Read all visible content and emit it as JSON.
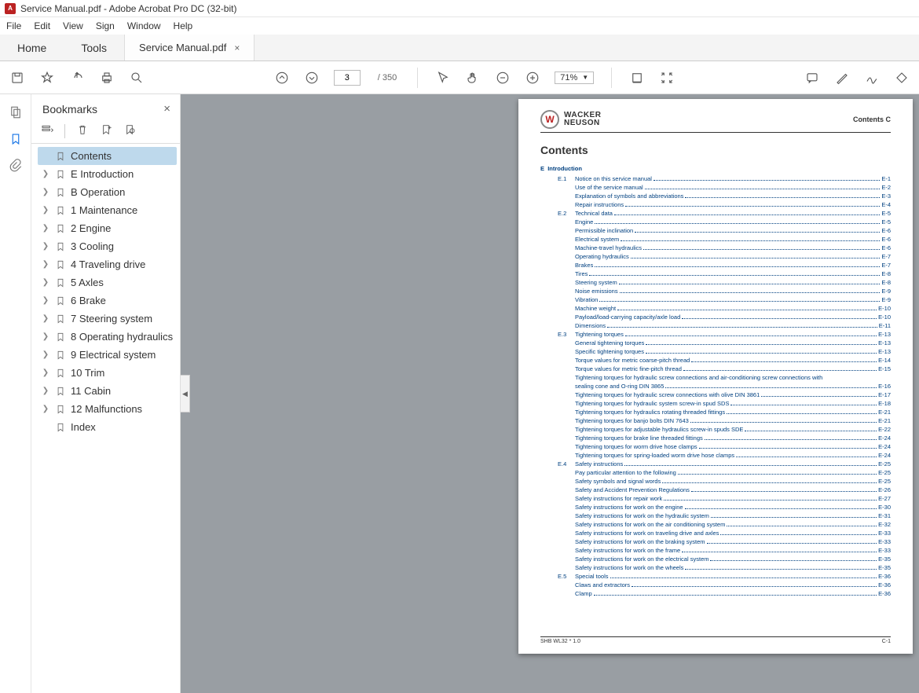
{
  "window_title": "Service Manual.pdf - Adobe Acrobat Pro DC (32-bit)",
  "menu": [
    "File",
    "Edit",
    "View",
    "Sign",
    "Window",
    "Help"
  ],
  "main_tabs": {
    "home": "Home",
    "tools": "Tools"
  },
  "doc_tab": "Service Manual.pdf",
  "page_current": "3",
  "page_total": "/ 350",
  "zoom": "71%",
  "sidebar_title": "Bookmarks",
  "bookmarks": [
    {
      "label": "Contents",
      "exp": false,
      "selected": true
    },
    {
      "label": "E Introduction",
      "exp": true
    },
    {
      "label": "B Operation",
      "exp": true
    },
    {
      "label": "1 Maintenance",
      "exp": true
    },
    {
      "label": "2 Engine",
      "exp": true
    },
    {
      "label": "3 Cooling",
      "exp": true
    },
    {
      "label": "4 Traveling drive",
      "exp": true
    },
    {
      "label": "5 Axles",
      "exp": true
    },
    {
      "label": "6 Brake",
      "exp": true
    },
    {
      "label": "7 Steering system",
      "exp": true
    },
    {
      "label": "8 Operating hydraulics",
      "exp": true
    },
    {
      "label": "9 Electrical system",
      "exp": true
    },
    {
      "label": "10 Trim",
      "exp": true
    },
    {
      "label": "11 Cabin",
      "exp": true
    },
    {
      "label": "12 Malfunctions",
      "exp": true
    },
    {
      "label": "Index",
      "exp": false
    }
  ],
  "page_header_right": "Contents  C",
  "brand_top": "WACKER",
  "brand_bottom": "NEUSON",
  "page_title": "Contents",
  "section_letter": "E",
  "section_title": "Introduction",
  "toc": [
    {
      "lvl": 1,
      "num": "E.1",
      "txt": "Notice on this service manual",
      "pg": "E-1"
    },
    {
      "lvl": 2,
      "txt": "Use of the service manual",
      "pg": "E-2"
    },
    {
      "lvl": 2,
      "txt": "Explanation of symbols and abbreviations",
      "pg": "E-3"
    },
    {
      "lvl": 2,
      "txt": "Repair instructions",
      "pg": "E-4"
    },
    {
      "lvl": 1,
      "num": "E.2",
      "txt": "Technical data",
      "pg": "E-5"
    },
    {
      "lvl": 2,
      "txt": "Engine",
      "pg": "E-5"
    },
    {
      "lvl": 2,
      "txt": "Permissible inclination",
      "pg": "E-6"
    },
    {
      "lvl": 2,
      "txt": "Electrical system",
      "pg": "E-6"
    },
    {
      "lvl": 2,
      "txt": "Machine-travel hydraulics",
      "pg": "E-6"
    },
    {
      "lvl": 2,
      "txt": "Operating hydraulics",
      "pg": "E-7"
    },
    {
      "lvl": 2,
      "txt": "Brakes",
      "pg": "E-7"
    },
    {
      "lvl": 2,
      "txt": "Tires",
      "pg": "E-8"
    },
    {
      "lvl": 2,
      "txt": "Steering system",
      "pg": "E-8"
    },
    {
      "lvl": 2,
      "txt": "Noise emissions",
      "pg": "E-9"
    },
    {
      "lvl": 2,
      "txt": "Vibration",
      "pg": "E-9"
    },
    {
      "lvl": 2,
      "txt": "Machine weight",
      "pg": "E-10"
    },
    {
      "lvl": 2,
      "txt": "Payload/load-carrying capacity/axle load",
      "pg": "E-10"
    },
    {
      "lvl": 2,
      "txt": "Dimensions",
      "pg": "E-11"
    },
    {
      "lvl": 1,
      "num": "E.3",
      "txt": "Tightening torques",
      "pg": "E-13"
    },
    {
      "lvl": 2,
      "txt": "General tightening torques",
      "pg": "E-13"
    },
    {
      "lvl": 2,
      "txt": "Specific tightening torques",
      "pg": "E-13"
    },
    {
      "lvl": 2,
      "txt": "Torque values for metric coarse-pitch thread",
      "pg": "E-14"
    },
    {
      "lvl": 2,
      "txt": "Torque values for metric fine-pitch thread",
      "pg": "E-15"
    },
    {
      "lvl": 2,
      "txt": "Tightening torques for hydraulic screw connections and air-conditioning screw connections with sealing cone and O-ring DIN 3865",
      "pg": "E-16",
      "wrap": true
    },
    {
      "lvl": 2,
      "txt": "Tightening torques for hydraulic screw connections with olive DIN 3861",
      "pg": "E-17"
    },
    {
      "lvl": 2,
      "txt": "Tightening torques for hydraulic system screw-in spud SDS",
      "pg": "E-18"
    },
    {
      "lvl": 2,
      "txt": "Tightening torques for hydraulics rotating threaded fittings",
      "pg": "E-21"
    },
    {
      "lvl": 2,
      "txt": "Tightening torques for banjo bolts DIN 7643",
      "pg": "E-21"
    },
    {
      "lvl": 2,
      "txt": "Tightening torques for adjustable hydraulics screw-in spuds SDE",
      "pg": "E-22"
    },
    {
      "lvl": 2,
      "txt": "Tightening torques for brake line threaded fittings",
      "pg": "E-24"
    },
    {
      "lvl": 2,
      "txt": "Tightening torques for worm drive hose clamps",
      "pg": "E-24"
    },
    {
      "lvl": 2,
      "txt": "Tightening torques for spring-loaded worm drive hose clamps",
      "pg": "E-24"
    },
    {
      "lvl": 1,
      "num": "E.4",
      "txt": "Safety instructions",
      "pg": "E-25"
    },
    {
      "lvl": 2,
      "txt": "Pay particular attention to the following",
      "pg": "E-25"
    },
    {
      "lvl": 2,
      "txt": "Safety symbols and signal words",
      "pg": "E-25"
    },
    {
      "lvl": 2,
      "txt": "Safety and Accident Prevention Regulations",
      "pg": "E-26"
    },
    {
      "lvl": 2,
      "txt": "Safety instructions for repair work",
      "pg": "E-27"
    },
    {
      "lvl": 2,
      "txt": "Safety instructions for work on the engine",
      "pg": "E-30"
    },
    {
      "lvl": 2,
      "txt": "Safety instructions for work on the hydraulic system",
      "pg": "E-31"
    },
    {
      "lvl": 2,
      "txt": "Safety instructions for work on the air conditioning system",
      "pg": "E-32"
    },
    {
      "lvl": 2,
      "txt": "Safety instructions for work on traveling drive and axles",
      "pg": "E-33"
    },
    {
      "lvl": 2,
      "txt": "Safety instructions for work on the braking system",
      "pg": "E-33"
    },
    {
      "lvl": 2,
      "txt": "Safety instructions for work on the frame",
      "pg": "E-33"
    },
    {
      "lvl": 2,
      "txt": "Safety instructions for work on the electrical system",
      "pg": "E-35"
    },
    {
      "lvl": 2,
      "txt": "Safety instructions for work on the wheels",
      "pg": "E-35"
    },
    {
      "lvl": 1,
      "num": "E.5",
      "txt": "Special tools",
      "pg": "E-36"
    },
    {
      "lvl": 2,
      "txt": "Claws and extractors",
      "pg": "E-36"
    },
    {
      "lvl": 2,
      "txt": "Clamp",
      "pg": "E-36"
    }
  ],
  "footer_left": "SHB WL32 *  1.0",
  "footer_right": "C-1"
}
